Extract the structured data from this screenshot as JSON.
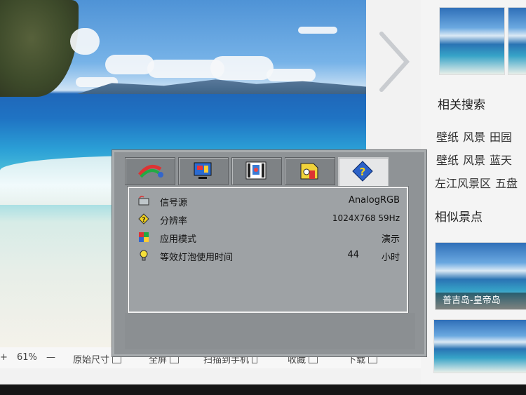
{
  "osd": {
    "tabs": [
      {
        "name": "color",
        "icon": "palette-icon"
      },
      {
        "name": "display",
        "icon": "display-icon"
      },
      {
        "name": "settings",
        "icon": "settings-icon"
      },
      {
        "name": "options",
        "icon": "options-icon"
      },
      {
        "name": "information",
        "icon": "question-icon",
        "active": true
      }
    ],
    "rows": [
      {
        "label": "信号源",
        "value": "AnalogRGB",
        "unit": "",
        "icon": "signal-source-icon"
      },
      {
        "label": "分辨率",
        "value": "1024X768 59Hz",
        "unit": "",
        "icon": "resolution-icon"
      },
      {
        "label": "应用模式",
        "value": "演示",
        "unit": "",
        "icon": "app-mode-icon"
      },
      {
        "label": "等效灯泡使用时间",
        "value": "44",
        "unit": "小时",
        "icon": "lamp-icon"
      }
    ]
  },
  "viewer_toolbar": {
    "plus": "+",
    "zoom": "61%",
    "minus": "—",
    "original_size": "原始尺寸",
    "fullscreen": "全屏",
    "scan_to_phone": "扫描到手机",
    "favorite": "收藏",
    "download": "下载"
  },
  "sidebar": {
    "related_search_title": "相关搜索",
    "related_row1": [
      "壁纸",
      "风景",
      "田园"
    ],
    "related_row2": [
      "壁纸",
      "风景",
      "蓝天"
    ],
    "related_row3": [
      "左江风景区",
      "五盘"
    ],
    "similar_title": "相似景点",
    "similar_caption": "普吉岛-皇帝岛"
  },
  "colors": {
    "osd_bg": "#8f9396",
    "osd_active_tab": "#e6e7e8"
  }
}
